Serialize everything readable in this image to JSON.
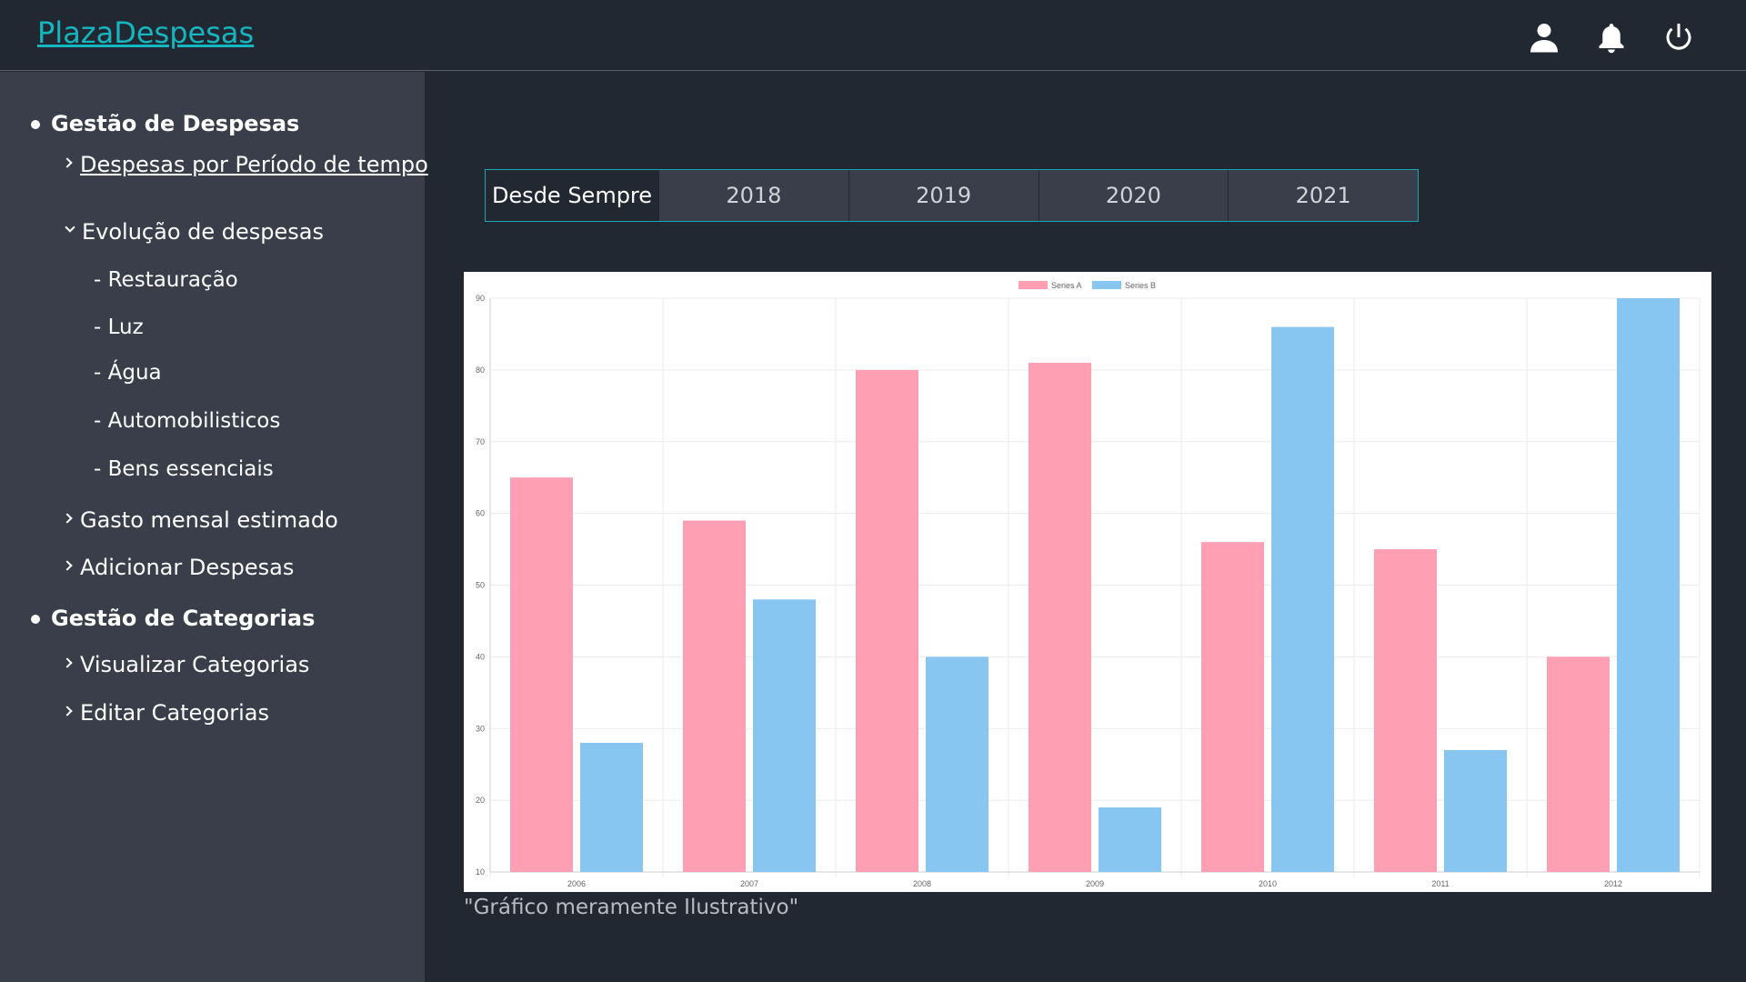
{
  "header": {
    "brand": "PlazaDespesas",
    "icons": [
      "user-icon",
      "bell-icon",
      "power-icon"
    ]
  },
  "sidebar": {
    "sections": [
      {
        "label": "Gestão de Despesas"
      },
      {
        "label": "Gestão de Categorias"
      }
    ],
    "links": {
      "periodo": "Despesas por Período de tempo",
      "evolucao": "Evolução de despesas",
      "gasto": "Gasto mensal estimado",
      "adicionar": "Adicionar Despesas",
      "visualizar": "Visualizar Categorias",
      "editar": "Editar Categorias"
    },
    "sub_items": [
      "- Restauração",
      "- Luz",
      "- Água",
      "- Automobilisticos",
      "- Bens essenciais"
    ]
  },
  "tabs": [
    "Desde Sempre",
    "2018",
    "2019",
    "2020",
    "2021"
  ],
  "active_tab": "Desde Sempre",
  "caption": "\"Gráfico meramente Ilustrativo\"",
  "colors": {
    "accent": "#16b6c1",
    "series_a": "#ff9fb3",
    "series_b": "#88c6f2"
  },
  "chart_data": {
    "type": "bar",
    "categories": [
      "2006",
      "2007",
      "2008",
      "2009",
      "2010",
      "2011",
      "2012"
    ],
    "series": [
      {
        "name": "Series A",
        "values": [
          65,
          59,
          80,
          81,
          56,
          55,
          40
        ]
      },
      {
        "name": "Series B",
        "values": [
          28,
          48,
          40,
          19,
          86,
          27,
          90
        ]
      }
    ],
    "ylim": [
      10,
      90
    ],
    "yticks": [
      10,
      20,
      30,
      40,
      50,
      60,
      70,
      80,
      90
    ],
    "grid": true,
    "legend": "top-center"
  }
}
